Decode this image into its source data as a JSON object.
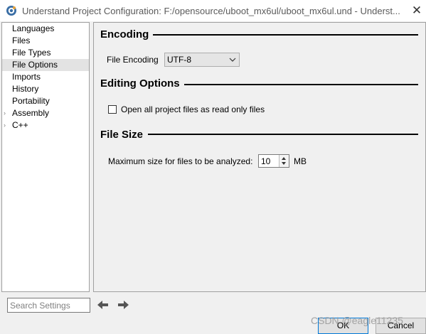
{
  "window": {
    "title": "Understand Project Configuration: F:/opensource/uboot_mx6ul/uboot_mx6ul.und - Underst...",
    "close_glyph": "✕"
  },
  "sidebar": {
    "items": [
      {
        "label": "Languages",
        "selected": false,
        "expandable": false
      },
      {
        "label": "Files",
        "selected": false,
        "expandable": false
      },
      {
        "label": "File Types",
        "selected": false,
        "expandable": false
      },
      {
        "label": "File Options",
        "selected": true,
        "expandable": false
      },
      {
        "label": "Imports",
        "selected": false,
        "expandable": false
      },
      {
        "label": "History",
        "selected": false,
        "expandable": false
      },
      {
        "label": "Portability",
        "selected": false,
        "expandable": false
      },
      {
        "label": "Assembly",
        "selected": false,
        "expandable": true
      },
      {
        "label": "C++",
        "selected": false,
        "expandable": true
      }
    ],
    "expand_glyph": "›"
  },
  "content": {
    "encoding": {
      "title": "Encoding",
      "label": "File Encoding",
      "value": "UTF-8"
    },
    "editing": {
      "title": "Editing Options",
      "readonly_label": "Open all project files as read only files",
      "readonly_checked": false
    },
    "filesize": {
      "title": "File Size",
      "label": "Maximum size for files to be analyzed:",
      "value": "10",
      "unit": "MB"
    }
  },
  "footer": {
    "search_placeholder": "Search Settings",
    "ok_label": "OK",
    "cancel_label": "Cancel",
    "watermark": "CSDN @eagle11235"
  },
  "icons": {
    "app": "understand-logo-icon",
    "back": "arrow-left-icon",
    "forward": "arrow-right-icon"
  },
  "colors": {
    "selected_row": "#e3e3e3",
    "default_button_border": "#0078d7"
  }
}
